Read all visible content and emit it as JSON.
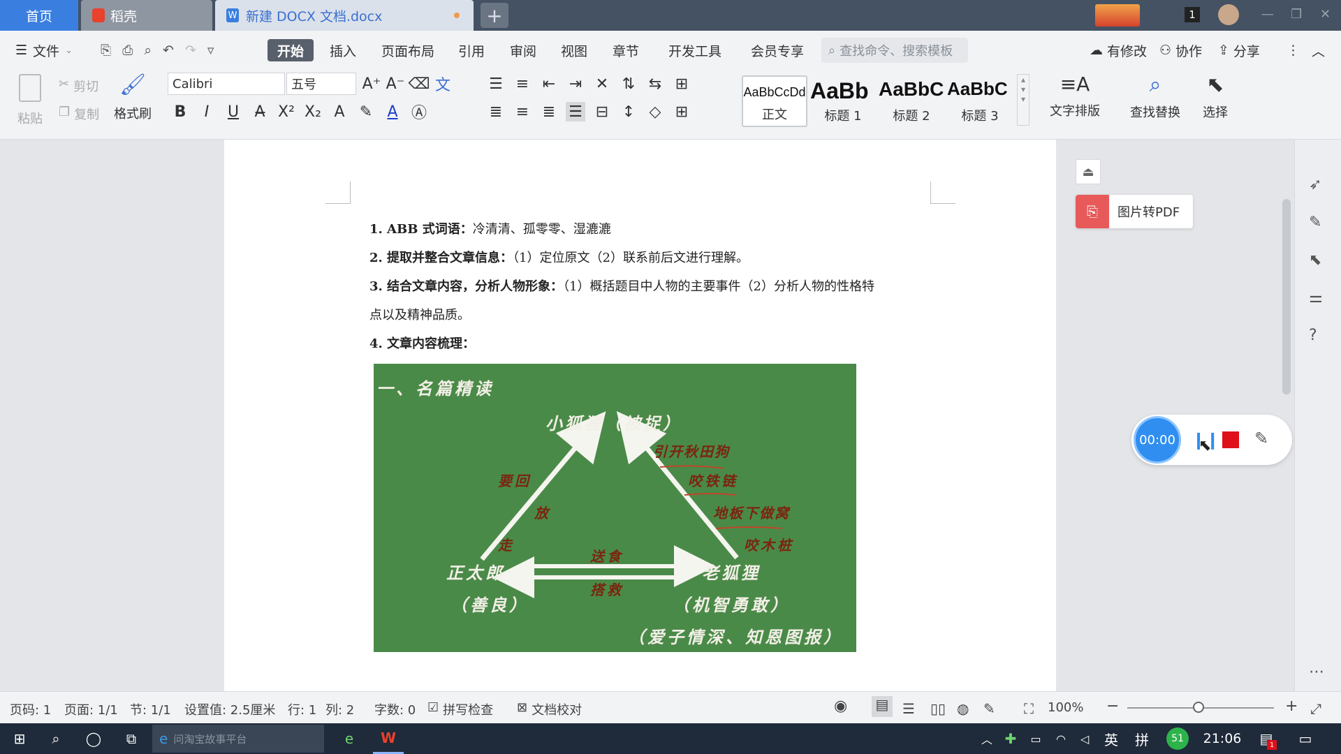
{
  "tabs": {
    "home": "首页",
    "daoke": "稻壳",
    "doc": "新建 DOCX 文档.docx",
    "new": "+"
  },
  "title_badge": "1",
  "menu": {
    "file": "文件",
    "items": [
      "开始",
      "插入",
      "页面布局",
      "引用",
      "审阅",
      "视图",
      "章节",
      "开发工具",
      "会员专享"
    ],
    "search_placeholder": "查找命令、搜索模板",
    "modified": "有修改",
    "collab": "协作",
    "share": "分享"
  },
  "ribbon": {
    "paste": "粘贴",
    "cut": "剪切",
    "copy": "复制",
    "format_painter": "格式刷",
    "font": "Calibri",
    "size": "五号",
    "styles": [
      {
        "preview": "AaBbCcDd",
        "label": "正文"
      },
      {
        "preview": "AaBb",
        "label": "标题 1"
      },
      {
        "preview": "AaBbC",
        "label": "标题 2"
      },
      {
        "preview": "AaBbC",
        "label": "标题 3"
      }
    ],
    "text_layout": "文字排版",
    "find_replace": "查找替换",
    "select": "选择"
  },
  "doc": {
    "l1b": "1. ABB 式词语：",
    "l1": "冷清清、孤零零、湿漉漉",
    "l2b": "2. 提取并整合文章信息：",
    "l2": "（1）定位原文（2）联系前后文进行理解。",
    "l3b": "3. 结合文章内容，分析人物形象：",
    "l3": "（1）概括题目中人物的主要事件（2）分析人物的性格特",
    "l3c": "点以及精神品质。",
    "l4b": "4. 文章内容梳理：",
    "figure": {
      "heading": "一、名篇精读",
      "top": "小狐狸（被捉）",
      "left": "正太郎",
      "left_sub": "（善良）",
      "right": "老狐狸",
      "right_sub": "（机智勇敢）",
      "right_sub2": "（爱子情深、知恩图报）",
      "notes": [
        "要回",
        "放",
        "走",
        "送食",
        "搭救",
        "引开秋田狗",
        "咬铁链",
        "地板下做窝",
        "咬木桩"
      ]
    }
  },
  "float": {
    "pdf": "图片转PDF",
    "timer": "00:00"
  },
  "status": {
    "pageno": "页码: 1",
    "pages": "页面: 1/1",
    "section": "节: 1/1",
    "setting": "设置值: 2.5厘米",
    "row": "行: 1",
    "col": "列: 2",
    "words": "字数: 0",
    "spell": "拼写检查",
    "proof": "文档校对",
    "zoom": "100%"
  },
  "taskbar": {
    "search_placeholder": "问淘宝故事平台",
    "ime1": "英",
    "ime2": "拼",
    "time": "21:06",
    "badge": "1",
    "net": "51"
  }
}
